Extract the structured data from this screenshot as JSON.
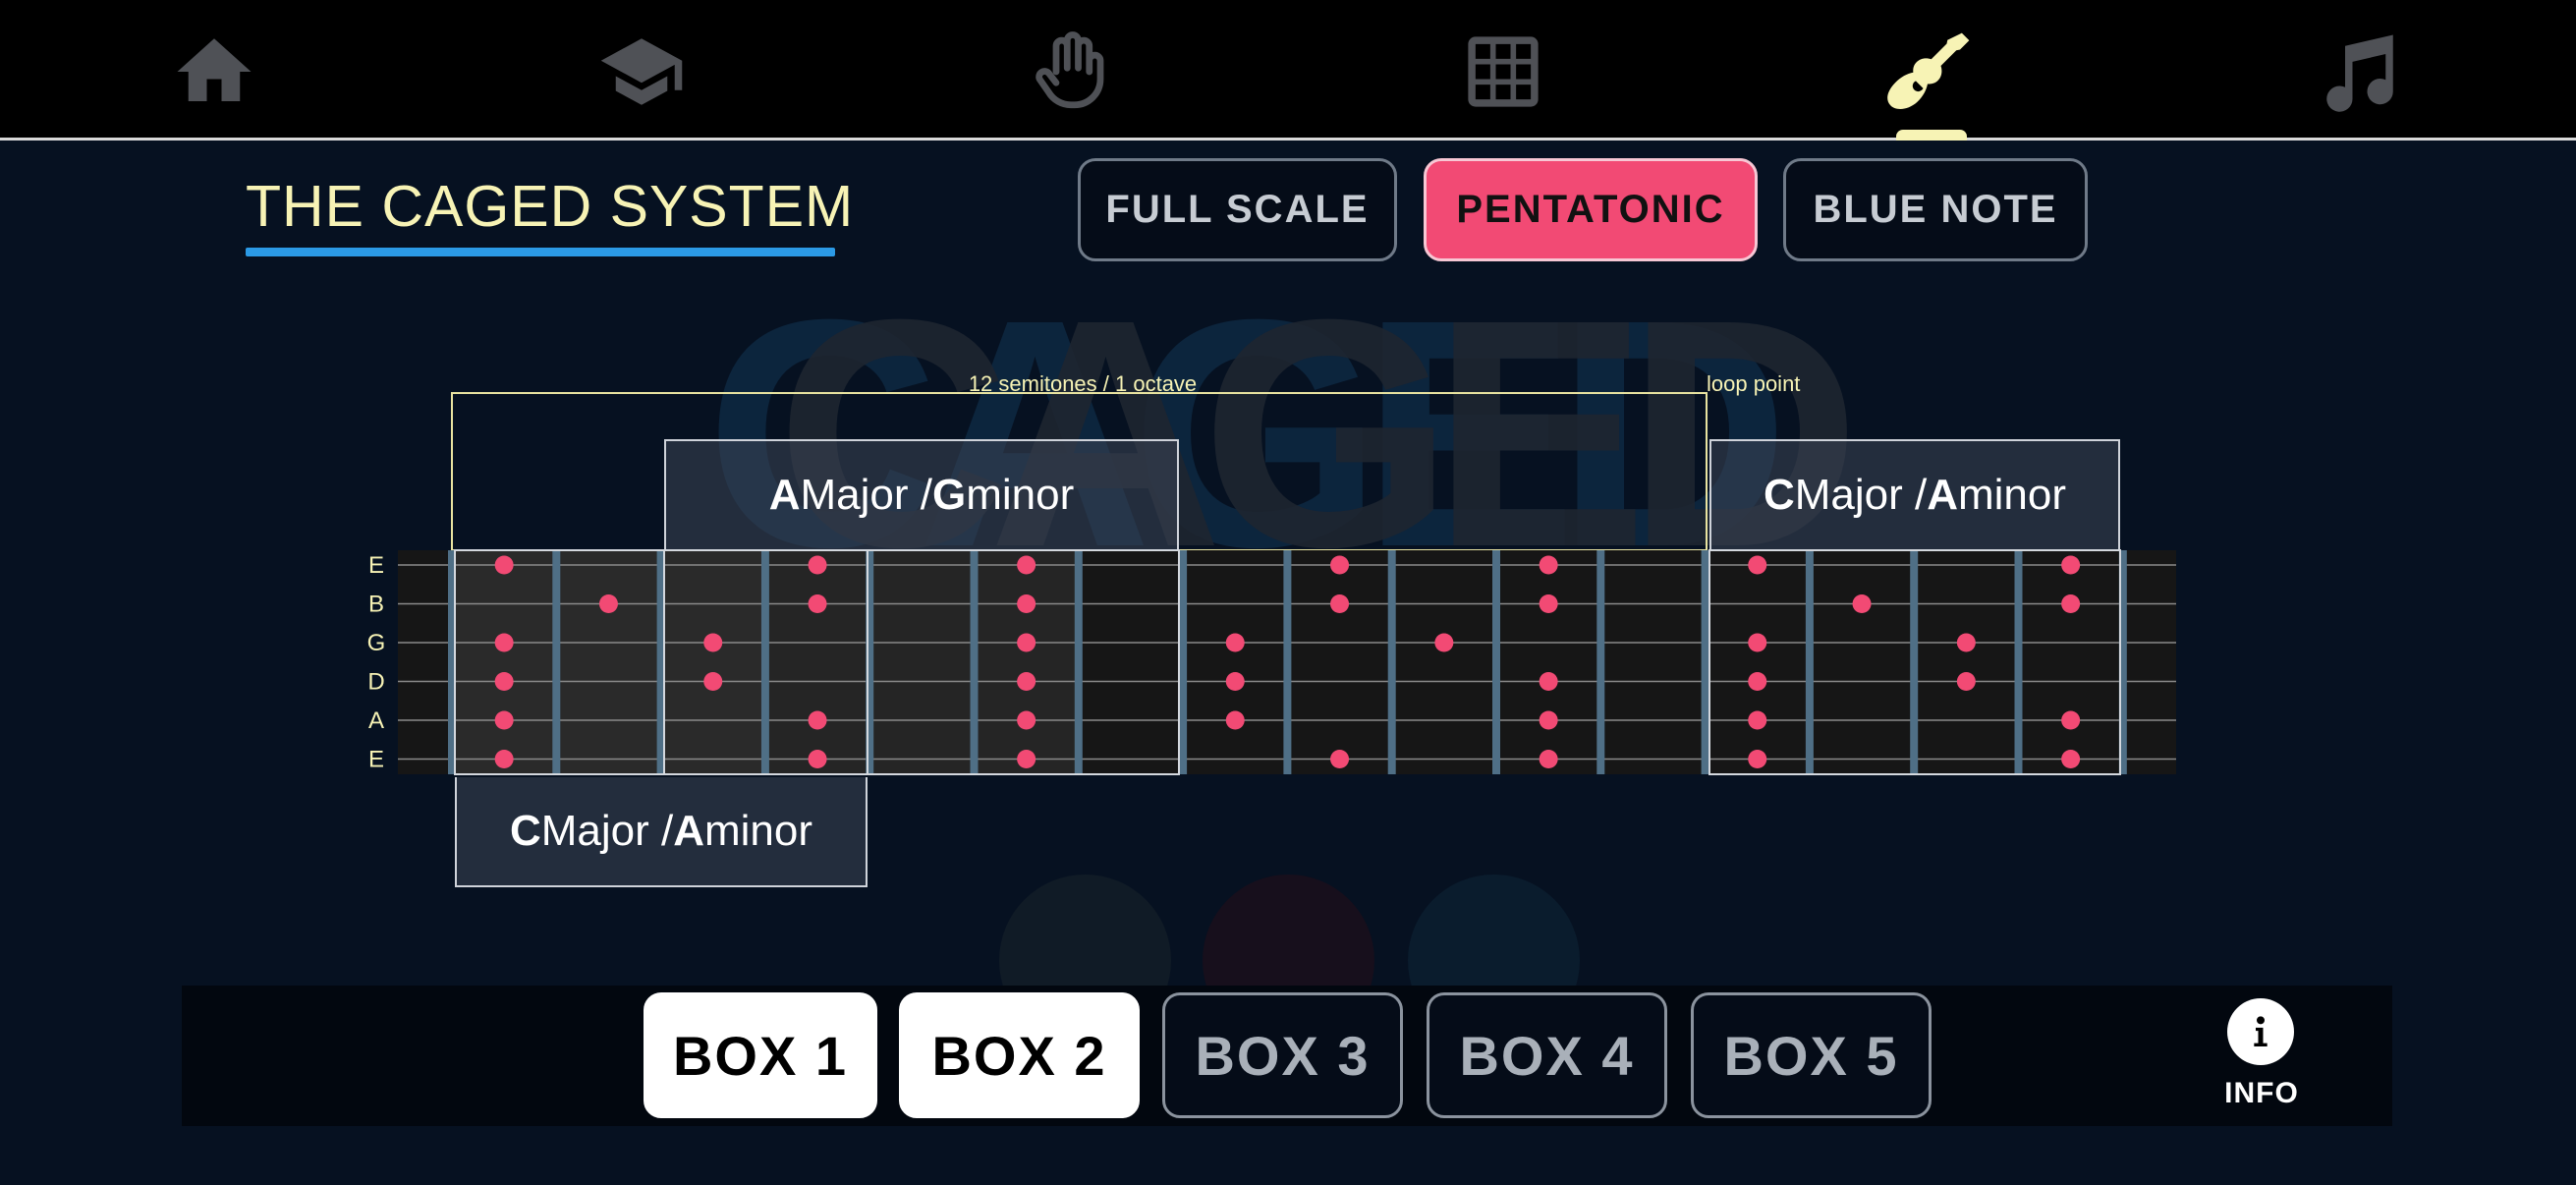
{
  "nav": {
    "items": [
      {
        "name": "home",
        "icon": "home-icon",
        "active": false
      },
      {
        "name": "learn",
        "icon": "graduation-cap-icon",
        "active": false
      },
      {
        "name": "hand",
        "icon": "hand-icon",
        "active": false
      },
      {
        "name": "grid",
        "icon": "grid-icon",
        "active": false
      },
      {
        "name": "guitar",
        "icon": "guitar-icon",
        "active": true
      },
      {
        "name": "music",
        "icon": "music-note-icon",
        "active": false
      }
    ],
    "icon_color": "#4f5156",
    "active_color": "#f7f3b5"
  },
  "page": {
    "title": "THE CAGED SYSTEM"
  },
  "scale_buttons": [
    {
      "label": "FULL SCALE",
      "active": false
    },
    {
      "label": "PENTATONIC",
      "active": true
    },
    {
      "label": "BLUE NOTE",
      "active": false
    }
  ],
  "watermark_text": "CAGED",
  "fretboard": {
    "strings": [
      "E",
      "B",
      "G",
      "D",
      "A",
      "E"
    ],
    "octave_annotation": "12 semitones / 1 octave",
    "loop_annotation": "loop point",
    "notes": [
      {
        "fret": 0,
        "strings": [
          0,
          2,
          3,
          4,
          5
        ]
      },
      {
        "fret": 1,
        "strings": [
          1
        ]
      },
      {
        "fret": 2,
        "strings": [
          2,
          3
        ]
      },
      {
        "fret": 3,
        "strings": [
          0,
          1,
          4,
          5
        ]
      },
      {
        "fret": 5,
        "strings": [
          0,
          1,
          2,
          3,
          4,
          5
        ]
      },
      {
        "fret": 7,
        "strings": [
          2,
          3,
          4
        ]
      },
      {
        "fret": 8,
        "strings": [
          0,
          1,
          5
        ]
      },
      {
        "fret": 9,
        "strings": [
          2
        ]
      },
      {
        "fret": 10,
        "strings": [
          0,
          1,
          3,
          4,
          5
        ]
      },
      {
        "fret": 12,
        "strings": [
          0,
          2,
          3,
          4,
          5
        ]
      },
      {
        "fret": 13,
        "strings": [
          1
        ]
      },
      {
        "fret": 14,
        "strings": [
          2,
          3
        ]
      },
      {
        "fret": 15,
        "strings": [
          0,
          1,
          4,
          5
        ]
      }
    ],
    "note_color": "#f24a74"
  },
  "box_labels": {
    "a_major": {
      "key1": "A",
      "text1": " Major / ",
      "key2": "G",
      "text2": " minor"
    },
    "c_major_top": {
      "key1": "C",
      "text1": " Major / ",
      "key2": "A",
      "text2": " minor"
    },
    "c_major_bottom": {
      "key1": "C",
      "text1": " Major / ",
      "key2": "A",
      "text2": " minor"
    }
  },
  "box_buttons": [
    {
      "label": "BOX 1",
      "active": true
    },
    {
      "label": "BOX 2",
      "active": true
    },
    {
      "label": "BOX 3",
      "active": false
    },
    {
      "label": "BOX 4",
      "active": false
    },
    {
      "label": "BOX 5",
      "active": false
    }
  ],
  "info": {
    "label": "INFO",
    "icon": "info-icon"
  }
}
